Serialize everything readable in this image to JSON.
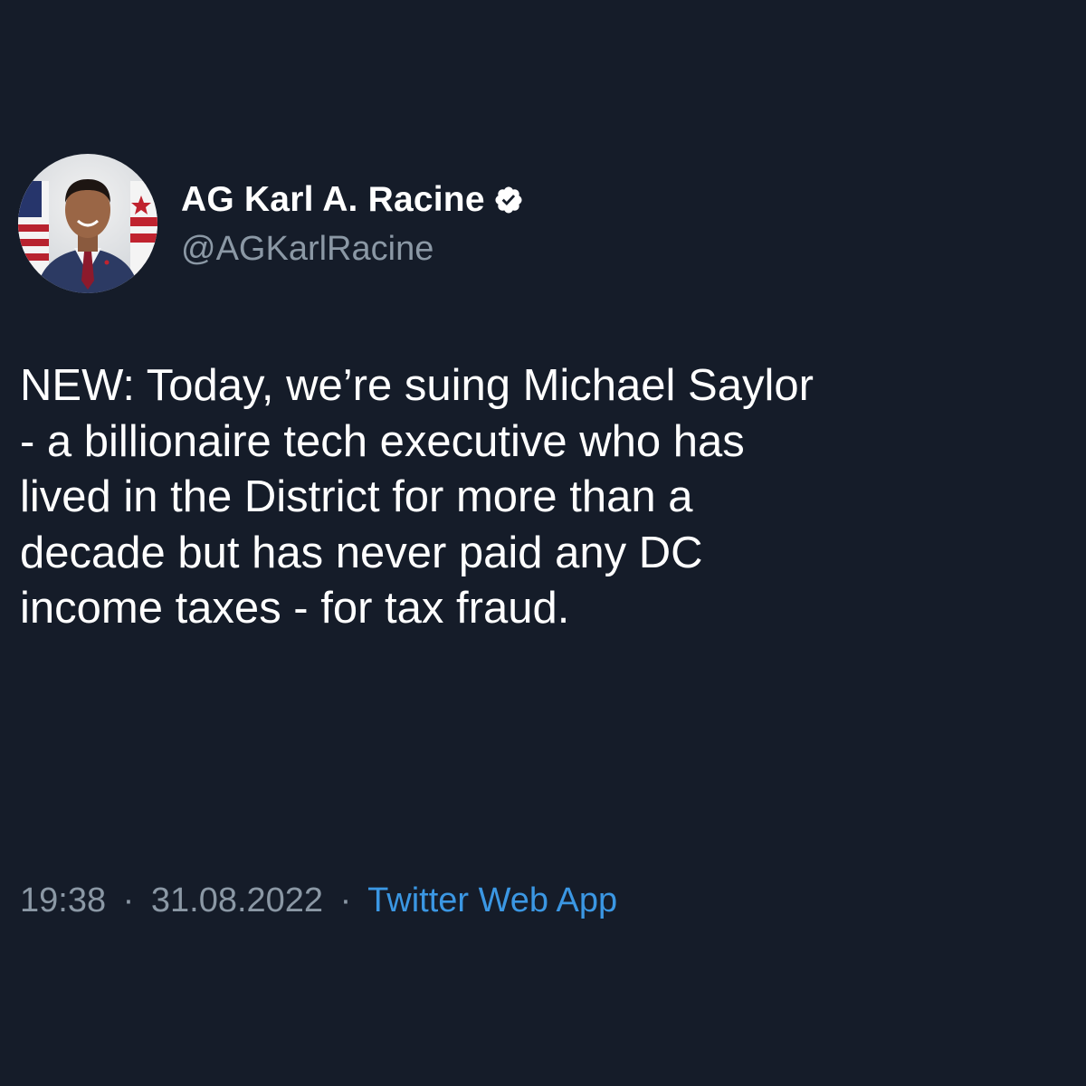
{
  "author": {
    "display_name": "AG Karl A. Racine",
    "handle": "@AGKarlRacine",
    "verified_icon": "verified-badge-icon",
    "avatar": "profile-photo"
  },
  "tweet": {
    "lines": [
      "NEW: Today, we’re suing Michael Saylor",
      "- a billionaire tech executive who has",
      "lived in the District for more than a",
      "decade but has never paid any DC",
      "income taxes - for tax fraud."
    ]
  },
  "meta": {
    "time": "19:38",
    "separator": "·",
    "date": "31.08.2022",
    "source": "Twitter Web App"
  },
  "colors": {
    "background": "#151c29",
    "primary_text": "#ffffff",
    "secondary_text": "#8b98a5",
    "link": "#3b97e3"
  }
}
